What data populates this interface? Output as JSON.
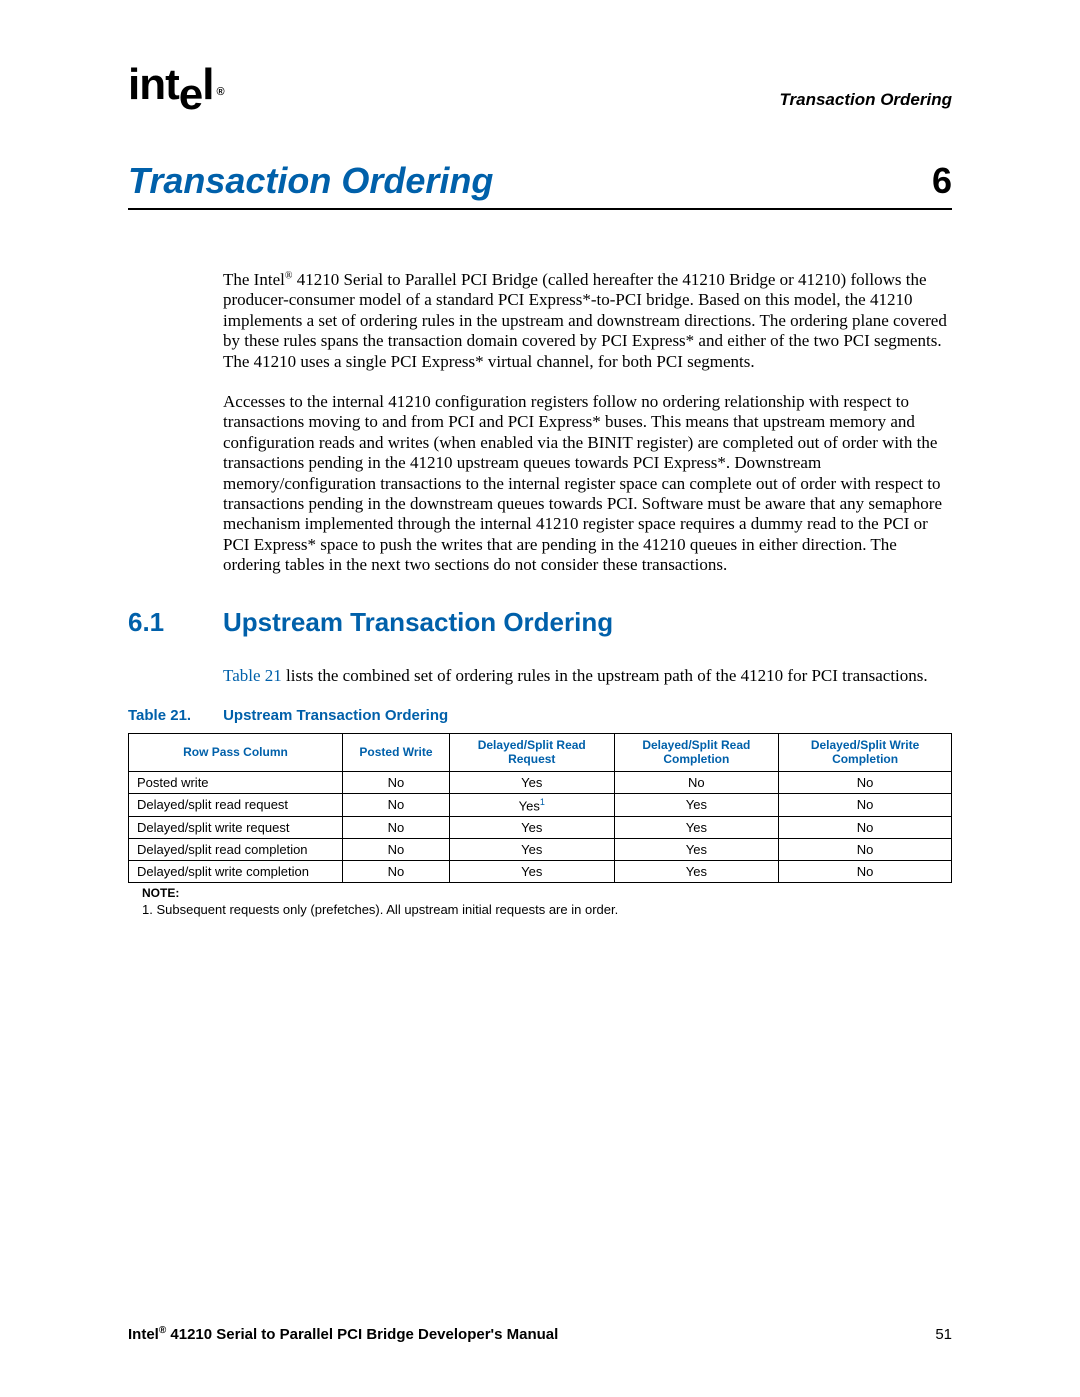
{
  "header": {
    "logo_text": "intel",
    "running_head": "Transaction Ordering"
  },
  "chapter": {
    "title": "Transaction Ordering",
    "number": "6"
  },
  "intro_para_prefix": "The Intel",
  "intro_para_suffix": " 41210 Serial to Parallel PCI Bridge (called hereafter the 41210 Bridge or 41210) follows the producer-consumer model of a standard PCI Express*-to-PCI bridge. Based on this model, the 41210 implements a set of ordering rules in the upstream and downstream directions. The ordering plane covered by these rules spans the transaction domain covered by PCI Express* and either of the two PCI segments. The 41210 uses a single PCI Express* virtual channel, for both PCI segments.",
  "para2": "Accesses to the internal 41210 configuration registers follow no ordering relationship with respect to transactions moving to and from PCI and PCI Express* buses. This means that upstream memory and configuration reads and writes (when enabled via the BINIT register) are completed out of order with the transactions pending in the 41210 upstream queues towards PCI Express*. Downstream memory/configuration transactions to the internal register space can complete out of order with respect to transactions pending in the downstream queues towards PCI. Software must be aware that any semaphore mechanism implemented through the internal 41210 register space requires a dummy read to the PCI or PCI Express* space to push the writes that are pending in the 41210 queues in either direction. The ordering tables in the next two sections do not consider these transactions.",
  "section": {
    "number": "6.1",
    "title": "Upstream Transaction Ordering"
  },
  "section_intro_ref": "Table 21",
  "section_intro_rest": " lists the combined set of ordering rules in the upstream path of the 41210 for PCI transactions.",
  "table": {
    "caption_label": "Table 21.",
    "caption_title": "Upstream Transaction Ordering",
    "headers": {
      "c0": "Row Pass Column",
      "c1": "Posted Write",
      "c2": "Delayed/Split Read Request",
      "c3": "Delayed/Split Read Completion",
      "c4": "Delayed/Split Write Completion"
    },
    "rows": [
      {
        "name": "Posted write",
        "c1": "No",
        "c2": "Yes",
        "c3": "No",
        "c4": "No",
        "fn": ""
      },
      {
        "name": "Delayed/split read request",
        "c1": "No",
        "c2": "Yes",
        "c3": "Yes",
        "c4": "No",
        "fn": "1"
      },
      {
        "name": "Delayed/split write request",
        "c1": "No",
        "c2": "Yes",
        "c3": "Yes",
        "c4": "No",
        "fn": ""
      },
      {
        "name": "Delayed/split read completion",
        "c1": "No",
        "c2": "Yes",
        "c3": "Yes",
        "c4": "No",
        "fn": ""
      },
      {
        "name": "Delayed/split write completion",
        "c1": "No",
        "c2": "Yes",
        "c3": "Yes",
        "c4": "No",
        "fn": ""
      }
    ],
    "note_label": "NOTE:",
    "note_item": "1. Subsequent requests only (prefetches). All upstream initial requests are in order."
  },
  "footer": {
    "left_prefix": "Intel",
    "left_suffix": " 41210 Serial to Parallel PCI Bridge Developer's Manual",
    "page": "51"
  }
}
